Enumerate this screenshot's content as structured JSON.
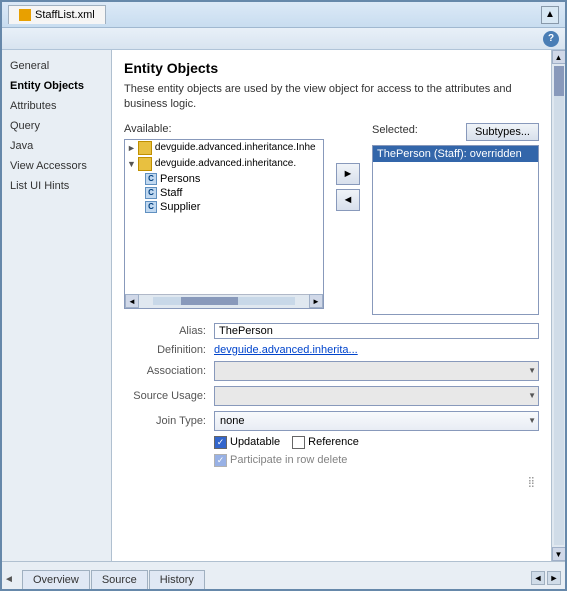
{
  "titlebar": {
    "tab_label": "StaffList.xml",
    "expand_icon": "▲"
  },
  "helpbar": {
    "help_label": "?"
  },
  "sidebar": {
    "items": [
      {
        "id": "general",
        "label": "General",
        "active": false
      },
      {
        "id": "entity-objects",
        "label": "Entity Objects",
        "active": true
      },
      {
        "id": "attributes",
        "label": "Attributes",
        "active": false
      },
      {
        "id": "query",
        "label": "Query",
        "active": false
      },
      {
        "id": "java",
        "label": "Java",
        "active": false
      },
      {
        "id": "view-accessors",
        "label": "View Accessors",
        "active": false
      },
      {
        "id": "list-ui-hints",
        "label": "List UI Hints",
        "active": false
      }
    ]
  },
  "content": {
    "title": "Entity Objects",
    "description": "These entity objects are used by the view object for access to the attributes and business logic.",
    "available_label": "Available:",
    "selected_label": "Selected:",
    "subtypes_button": "Subtypes...",
    "tree_items": [
      {
        "label": "devguide.advanced.inheritance.Inhe",
        "indent": 0,
        "type": "pkg",
        "arrow": "►"
      },
      {
        "label": "devguide.advanced.inheritance.",
        "indent": 0,
        "type": "pkg",
        "arrow": "▼"
      },
      {
        "label": "Persons",
        "indent": 1,
        "type": "class"
      },
      {
        "label": "Staff",
        "indent": 1,
        "type": "class"
      },
      {
        "label": "Supplier",
        "indent": 1,
        "type": "class"
      }
    ],
    "selected_items": [
      {
        "label": "ThePerson (Staff): overridden"
      }
    ],
    "add_arrow": "►",
    "remove_arrow": "◄",
    "properties": {
      "alias_label": "Alias:",
      "alias_value": "ThePerson",
      "definition_label": "Definition:",
      "definition_value": "devguide.advanced.inherita...",
      "association_label": "Association:",
      "association_value": "",
      "source_usage_label": "Source Usage:",
      "source_usage_value": "",
      "join_type_label": "Join Type:",
      "join_type_value": "none",
      "updatable_label": "Updatable",
      "reference_label": "Reference",
      "participate_label": "Participate in row delete",
      "updatable_checked": true,
      "reference_checked": false,
      "participate_checked": true,
      "participate_disabled": true
    }
  },
  "bottom_tabs": {
    "items": [
      {
        "label": "Overview",
        "active": false
      },
      {
        "label": "Source",
        "active": false
      },
      {
        "label": "History",
        "active": false
      }
    ],
    "nav_arrow": "◄"
  }
}
